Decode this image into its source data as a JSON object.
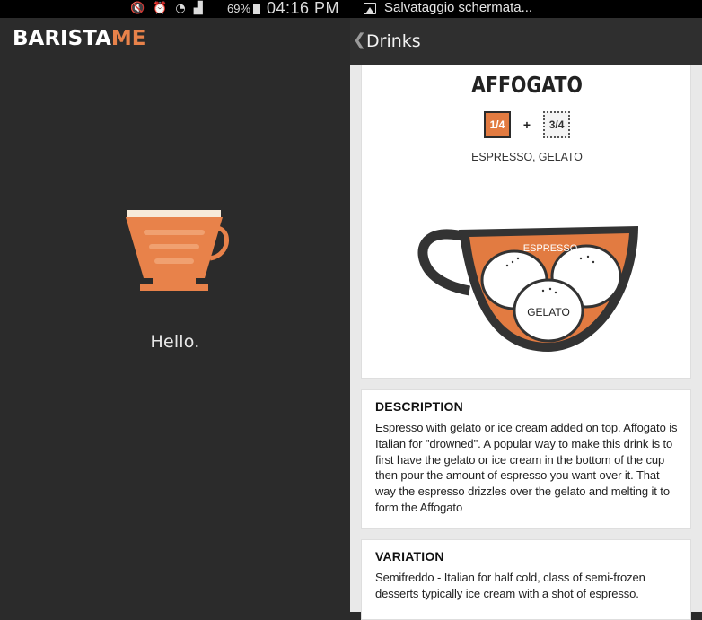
{
  "status_left": {
    "icons": [
      "mute-icon",
      "alarm-icon",
      "wifi-icon",
      "signal-icon"
    ],
    "battery": "69%",
    "time": "04:16 PM"
  },
  "status_right": {
    "notification": "Salvataggio schermata..."
  },
  "left": {
    "logo_main": "BARISTA",
    "logo_accent": "ME",
    "greeting": "Hello."
  },
  "right": {
    "back_label": "Drinks",
    "drink": {
      "name": "AFFOGATO",
      "ratio_espresso": "1/4",
      "ratio_plus": "+",
      "ratio_gelato": "3/4",
      "ingredients": "ESPRESSO, GELATO",
      "cup_label_top": "ESPRESSO",
      "cup_label_center": "GELATO"
    },
    "description": {
      "title": "DESCRIPTION",
      "text": "Espresso with gelato or ice cream added on top. Affogato is Italian for \"drowned\". A popular way to make this drink is to first have the gelato or ice cream in the bottom of the cup then pour the amount of espresso you want over it. That way the espresso drizzles over the gelato and melting it to form the Affogato"
    },
    "variation": {
      "title": "VARIATION",
      "text": "Semifreddo - Italian for half cold, class of semi-frozen desserts typically ice cream with a shot of espresso."
    }
  },
  "colors": {
    "accent": "#e8824a",
    "espresso_fill": "#e27b41",
    "dark_bg": "#2b2b2b",
    "card_bg": "#ffffff"
  }
}
